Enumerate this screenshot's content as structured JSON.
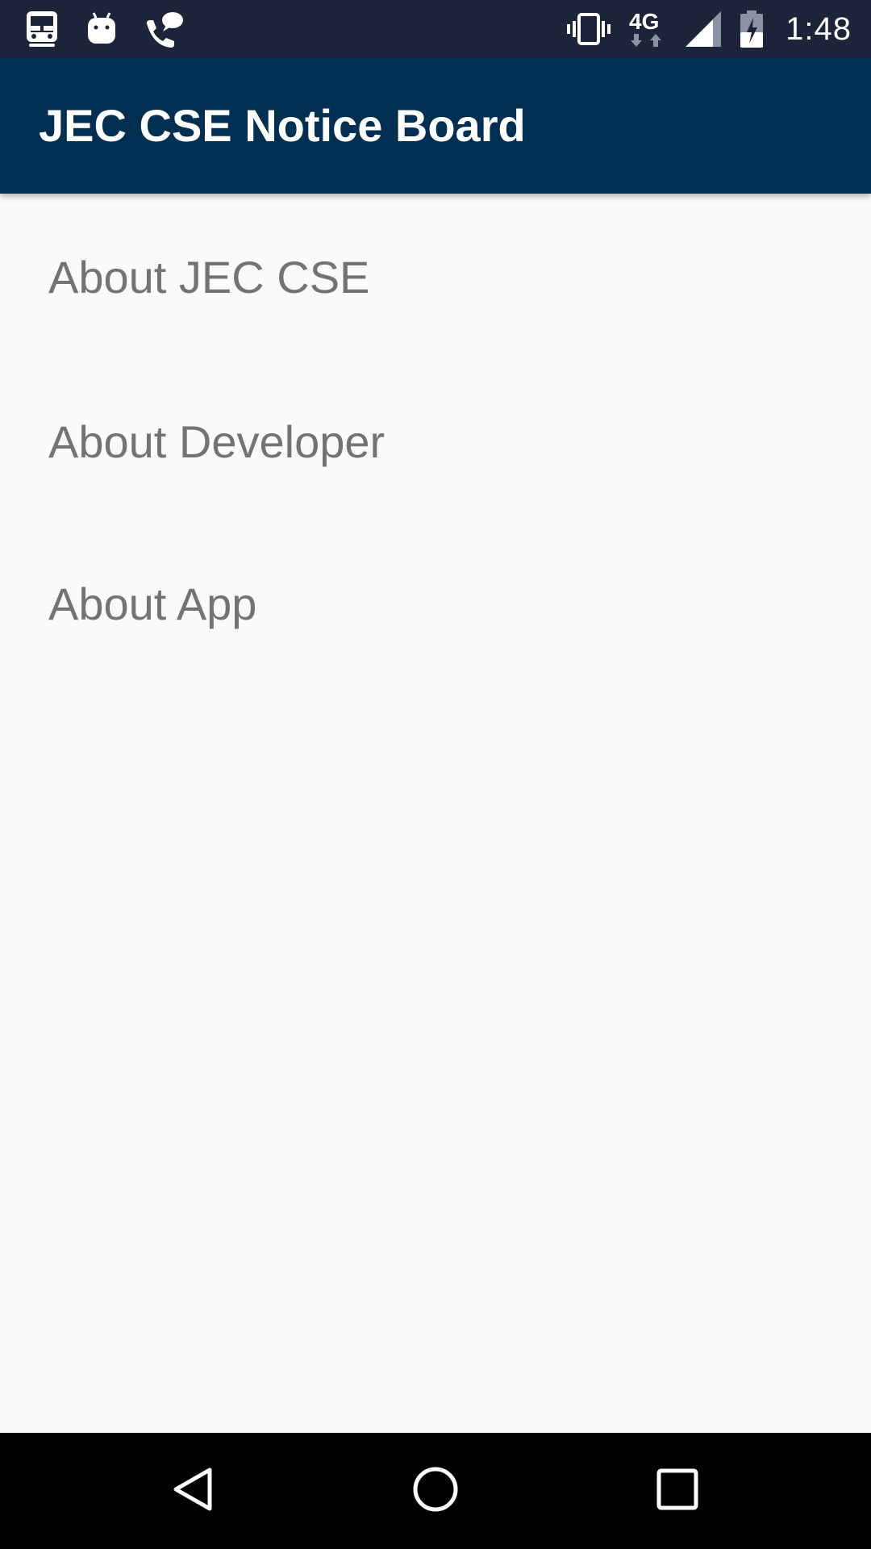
{
  "status_bar": {
    "time": "1:48",
    "network": "4G",
    "left_icons": [
      "train-icon",
      "android-icon",
      "phone-chat-icon"
    ],
    "right_icons": [
      "vibrate-icon",
      "network-4g-icon",
      "signal-icon",
      "battery-charging-icon"
    ]
  },
  "app_bar": {
    "title": "JEC CSE Notice Board",
    "background": "#002f52"
  },
  "menu": {
    "items": [
      {
        "label": "About JEC CSE"
      },
      {
        "label": "About Developer"
      },
      {
        "label": "About App"
      }
    ],
    "text_color": "#737373"
  },
  "nav_bar": {
    "buttons": [
      "back-icon",
      "home-icon",
      "recents-icon"
    ]
  }
}
